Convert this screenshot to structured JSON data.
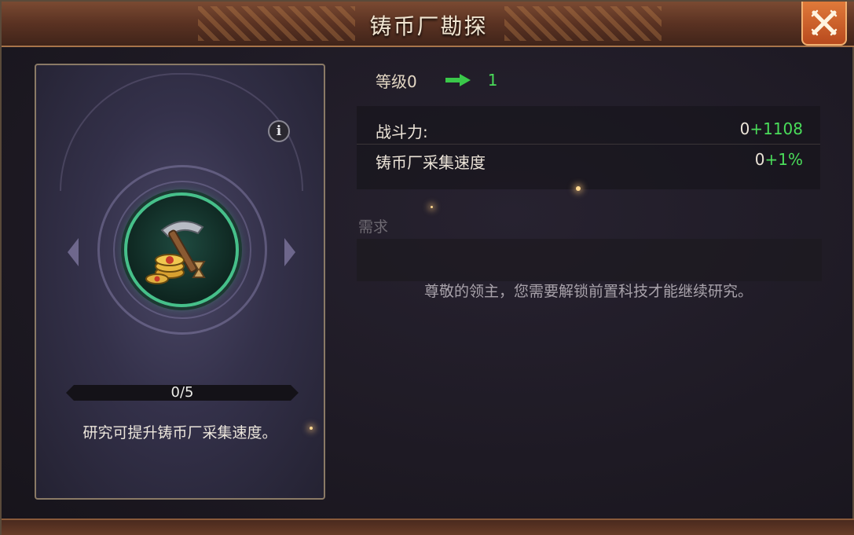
{
  "header": {
    "title": "铸币厂勘探",
    "close_icon": "close-icon"
  },
  "research_card": {
    "info_icon_glyph": "i",
    "emblem_icon": "mint-pickaxe-coins-icon",
    "progress": {
      "current": 0,
      "max": 5,
      "text": "0/5"
    },
    "description": "研究可提升铸币厂采集速度。"
  },
  "level": {
    "label": "等级0",
    "arrow_icon": "arrow-right-icon",
    "next": "1"
  },
  "stats": [
    {
      "label": "战斗力:",
      "base": "0",
      "bonus": "+1108"
    },
    {
      "label": "铸币厂采集速度",
      "base": "0",
      "bonus": "+1%"
    }
  ],
  "requirements": {
    "label": "需求",
    "message": "尊敬的领主，您需要解锁前置科技才能继续研究。"
  },
  "colors": {
    "bonus_green": "#4adc5a",
    "emblem_ring": "#46c08a",
    "close_orange": "#e07a3a"
  }
}
